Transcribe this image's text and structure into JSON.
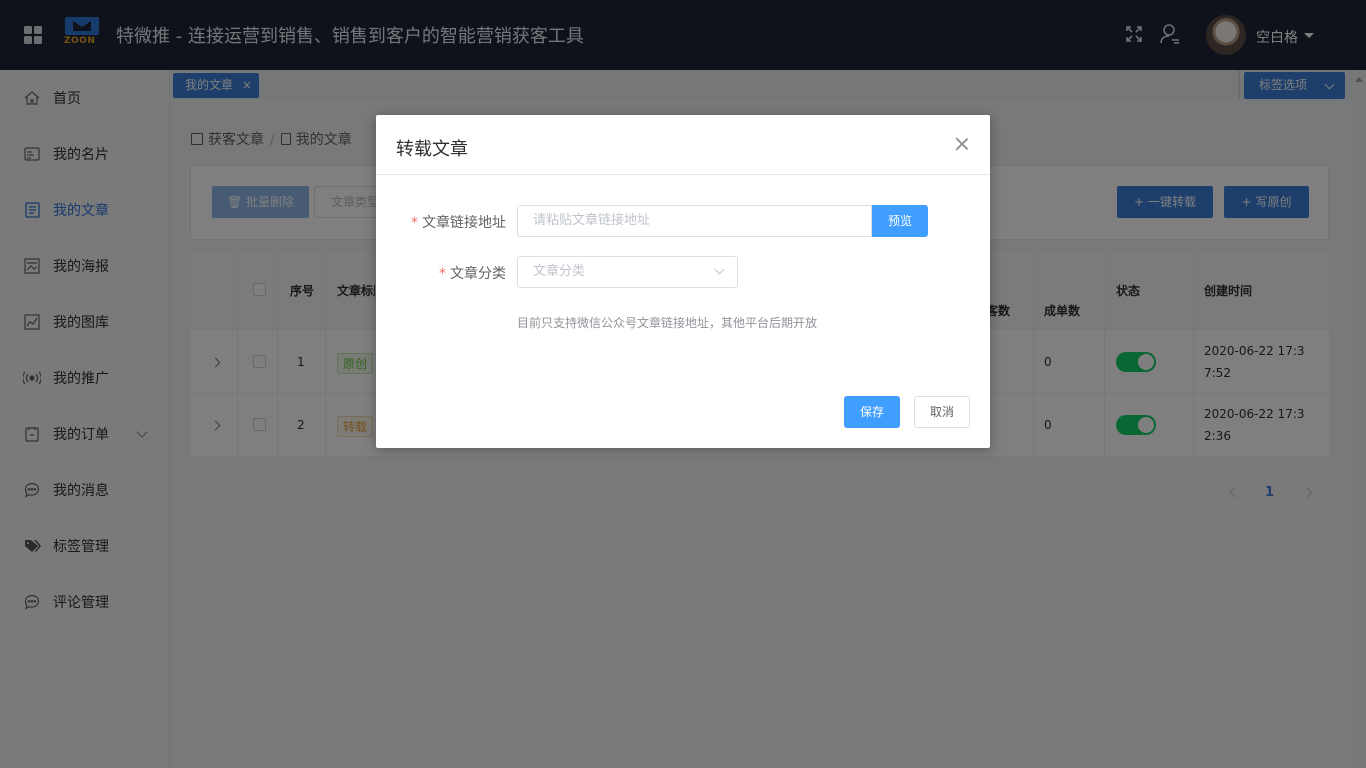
{
  "header": {
    "logo_text": "ZOON",
    "title": "特微推 - 连接运营到销售、销售到客户的智能营销获客工具",
    "username": "空白格"
  },
  "sidebar": {
    "items": [
      {
        "label": "首页",
        "icon": "home-icon"
      },
      {
        "label": "我的名片",
        "icon": "card-icon"
      },
      {
        "label": "我的文章",
        "icon": "article-icon",
        "active": true
      },
      {
        "label": "我的海报",
        "icon": "poster-icon"
      },
      {
        "label": "我的图库",
        "icon": "gallery-icon"
      },
      {
        "label": "我的推广",
        "icon": "broadcast-icon"
      },
      {
        "label": "我的订单",
        "icon": "order-icon",
        "has_submenu": true
      },
      {
        "label": "我的消息",
        "icon": "message-icon"
      },
      {
        "label": "标签管理",
        "icon": "tag-icon"
      },
      {
        "label": "评论管理",
        "icon": "comment-icon"
      }
    ]
  },
  "tags": {
    "active_tag": "我的文章",
    "close_glyph": "×",
    "options_label": "标签选项"
  },
  "breadcrumb": [
    "获客文章",
    "我的文章"
  ],
  "breadcrumb_separator": "/",
  "toolbar": {
    "batch_delete": "批量删除",
    "type_placeholder": "文章类型",
    "one_click_repost": "一键转载",
    "write_original": "写原创"
  },
  "table": {
    "headers": {
      "index": "序号",
      "title": "文章标题",
      "customers": "客数",
      "orders": "成单数",
      "status": "状态",
      "created": "创建时间"
    },
    "rows": [
      {
        "index": "1",
        "type": "原创",
        "orders": "0",
        "status_on": true,
        "created": "2020-06-22 17:37:52"
      },
      {
        "index": "2",
        "type": "转载",
        "orders": "0",
        "status_on": true,
        "created": "2020-06-22 17:32:36"
      }
    ]
  },
  "pagination": {
    "current": "1"
  },
  "modal": {
    "title": "转载文章",
    "url_label": "文章链接地址",
    "url_placeholder": "请粘贴文章链接地址",
    "preview_button": "预览",
    "category_label": "文章分类",
    "category_placeholder": "文章分类",
    "hint": "目前只支持微信公众号文章链接地址，其他平台后期开放",
    "save_button": "保存",
    "cancel_button": "取消",
    "required_mark": "*"
  },
  "colors": {
    "topbar": "#1e2535",
    "primary": "#3c7fd8",
    "modal_primary": "#409eff",
    "switch_on": "#13ce66",
    "required": "#f56c6c"
  }
}
